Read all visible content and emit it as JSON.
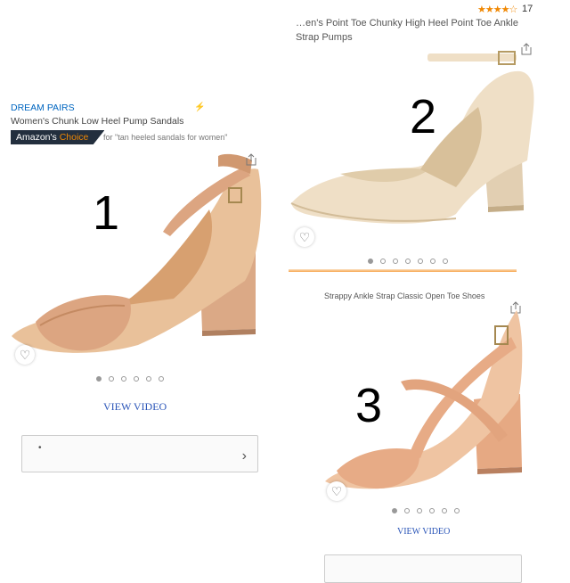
{
  "product1": {
    "brand": "DREAM PAIRS",
    "title": "Women's Chunk Low Heel Pump Sandals",
    "choice_label": "Amazon's",
    "choice_highlight": "Choice",
    "choice_for": "for \"tan heeled sandals for women\"",
    "number": "1",
    "dots": 6,
    "active_dot": 0,
    "video_link": "VIEW VIDEO",
    "shoe_color": "#d9a57e"
  },
  "product2": {
    "rating_count": "17",
    "rating_stars": "★★★★☆",
    "title_line1": "…en's Point Toe Chunky High Heel Point Toe Ankle",
    "title_line2": "Strap Pumps",
    "number": "2",
    "dots": 7,
    "active_dot": 0,
    "shoe_color": "#ecd9bf"
  },
  "product3": {
    "title": "Strappy Ankle Strap Classic Open Toe Shoes",
    "number": "3",
    "dots": 6,
    "active_dot": 0,
    "video_link": "VIEW VIDEO",
    "shoe_color": "#e6a77e"
  },
  "icons": {
    "heart": "♡",
    "chevron": "›",
    "bullet": "•"
  }
}
